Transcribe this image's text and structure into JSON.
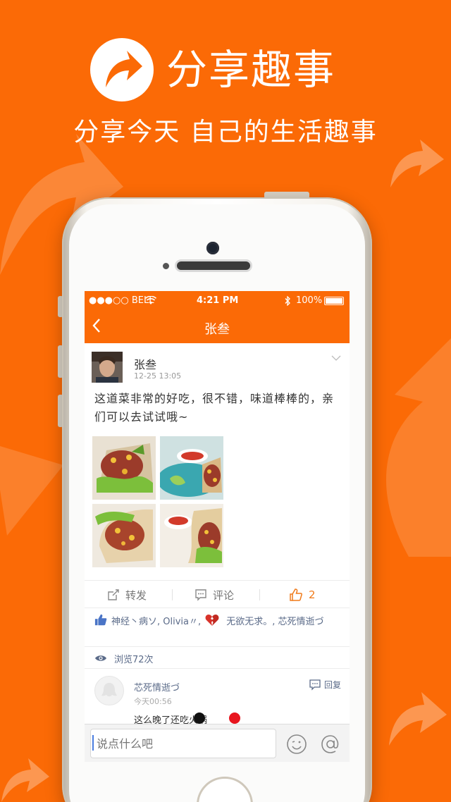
{
  "hero": {
    "title": "分享趣事",
    "subtitle": "分享今天 自己的生活趣事"
  },
  "status": {
    "carrier": "●●●○○ BELL",
    "time": "4:21 PM",
    "battery": "100%"
  },
  "nav": {
    "back_icon": "chevron-left-icon",
    "title": "张叁"
  },
  "post": {
    "author": "张叁",
    "time": "12-25 13:05",
    "content": "这道菜非常的好吃，很不错，味道棒棒的，亲们可以去试试哦~",
    "photo_count": 4
  },
  "actions": {
    "forward": "转发",
    "comment": "评论",
    "like_count": "2"
  },
  "likes": {
    "names": "神经丶病ソ, Olivia〃,",
    "names_after_icon": "无欲无求。, 芯死情逝づ"
  },
  "views": {
    "label": "浏览72次"
  },
  "comment": {
    "author": "芯死情逝づ",
    "time": "今天00:56",
    "text": "这么晚了还吃火锅",
    "reply_label": "回复"
  },
  "input": {
    "placeholder": "说点什么吧"
  },
  "colors": {
    "brand": "#fb6a06",
    "link": "#5b6b89",
    "like": "#f07a1a"
  }
}
